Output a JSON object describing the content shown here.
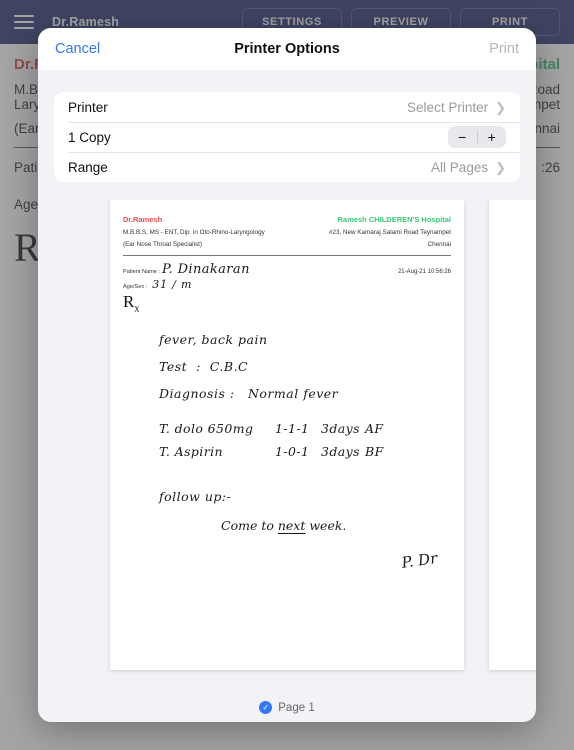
{
  "app": {
    "title": "Dr.Ramesh",
    "menu_icon": "hamburger-icon",
    "buttons": [
      {
        "label": "SETTINGS"
      },
      {
        "label": "PREVIEW"
      },
      {
        "label": "PRINT"
      }
    ],
    "header_bg": "#1e2a6e"
  },
  "background_sheet": {
    "doctor_name": "Dr.Ramesh",
    "qualifications": "M.B.B.S, MS - ENT, Dip. in Oto-Rhino-Laryngology",
    "specialty": "(Ear Nose Throat Specialist)",
    "hospital_name": "Ramesh CHILDEREN'S Hospital",
    "address_line1": "#23, New Kamaraj Salami  Road Teynampet",
    "address_line2": "Chennai",
    "patient_label": "Patient Name :",
    "age_label": "Age/Sex :",
    "timestamp_tail": ":26",
    "rx_symbol": "R",
    "rx_subscript": "x",
    "doctor_color": "#e03b3b",
    "hospital_color": "#2eb872"
  },
  "modal": {
    "cancel_label": "Cancel",
    "title": "Printer Options",
    "print_label": "Print",
    "accent_color": "#3478f6",
    "options": [
      {
        "label": "Printer",
        "value": "Select Printer",
        "chevron": "chevron-right-icon",
        "type": "disclosure"
      },
      {
        "label": "1 Copy",
        "value": "",
        "type": "stepper",
        "minus": "−",
        "plus": "+"
      },
      {
        "label": "Range",
        "value": "All Pages",
        "chevron": "chevron-right-icon",
        "type": "disclosure"
      }
    ]
  },
  "preview": {
    "page_label": "Page 1",
    "check_icon": "check-icon",
    "document": {
      "doctor_name": "Dr.Ramesh",
      "qualifications": "M.B.B.S, MS - ENT, Dip. in Oto-Rhino-Laryngology",
      "specialty": "(Ear Nose Throat Specialist)",
      "hospital_name": "Ramesh CHILDEREN'S Hospital",
      "address_line1": "#23, New Kamaraj Salami  Road Teynampet",
      "address_line2": "Chennai",
      "patient_label": "Patient Name :",
      "patient_name": "P. Dinakaran",
      "timestamp": "21-Aug-21 10:56:26",
      "age_label": "Age/Sex :",
      "age_sex": "31 / m",
      "rx_symbol": "R",
      "rx_subscript": "x",
      "complaint": "fever, back pain",
      "test": "Test  :  C.B.C",
      "diagnosis": "Diagnosis :   Normal fever",
      "medications": [
        {
          "drug": "T. dolo 650mg",
          "dose": "1-1-1",
          "duration": "3days",
          "timing": "AF"
        },
        {
          "drug": "T. Aspirin",
          "dose": "1-0-1",
          "duration": "3days",
          "timing": "BF"
        }
      ],
      "followup_label": "follow up:-",
      "followup_note_pre": "Come  to  ",
      "followup_note_underlined": "next",
      "followup_note_post": "  week.",
      "signature": "P. Dr",
      "doctor_color": "#e8504a",
      "hospital_color": "#3ec77c"
    }
  }
}
